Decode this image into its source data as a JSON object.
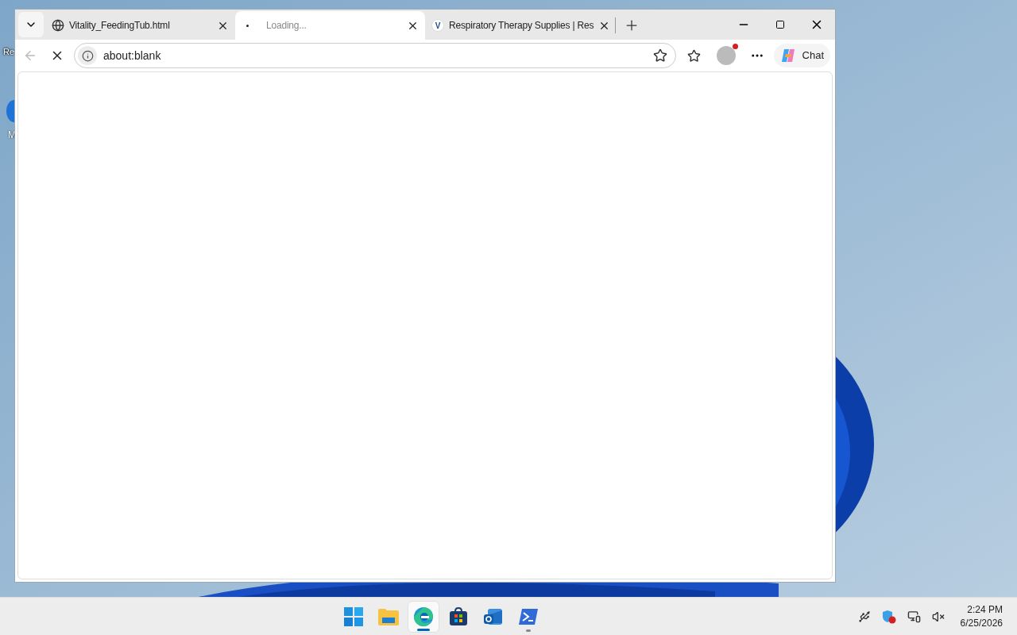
{
  "desktop": {
    "icons": [
      {
        "label": "Re"
      },
      {
        "label": "M"
      }
    ]
  },
  "browser": {
    "tabs": [
      {
        "title": "Vitality_FeedingTub.html",
        "kind": "globe",
        "selected": false
      },
      {
        "title": "Loading...",
        "kind": "loading",
        "selected": true
      },
      {
        "title": "Respiratory Therapy Supplies | Res",
        "kind": "site",
        "favicon": "V",
        "selected": false
      }
    ],
    "address": {
      "value": "about:blank"
    },
    "loading": true,
    "profile_notification": true,
    "chat_label": "Chat"
  },
  "taskbar": {
    "apps": [
      {
        "kind": "start",
        "open": false,
        "active": false
      },
      {
        "kind": "files",
        "open": false,
        "active": false
      },
      {
        "kind": "edge",
        "open": true,
        "active": true
      },
      {
        "kind": "store",
        "open": false,
        "active": false
      },
      {
        "kind": "outlook",
        "open": false,
        "active": false
      },
      {
        "kind": "terminal",
        "open": true,
        "active": false
      }
    ],
    "time": "2:24 PM",
    "date": "6/25/2026"
  }
}
